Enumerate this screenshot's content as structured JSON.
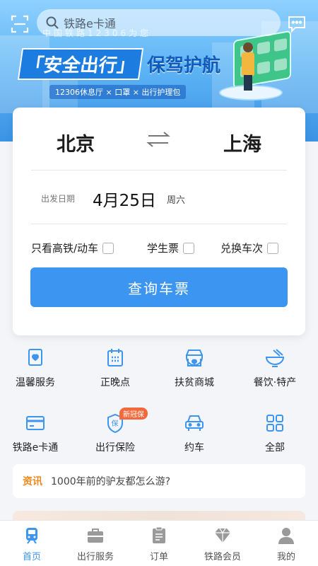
{
  "banner": {
    "subtitle": "中国铁路12306为您",
    "headline_main": "「安全出行」",
    "headline_rest": "保驾护航",
    "tagline": "12306休息厅 × 口罩 × 出行护理包"
  },
  "search": {
    "placeholder": "铁路e卡通"
  },
  "booking": {
    "from_city": "北京",
    "to_city": "上海",
    "date_label": "出发日期",
    "date_value": "4月25日",
    "weekday": "周六",
    "options": [
      {
        "label": "只看高铁/动车",
        "checked": false
      },
      {
        "label": "学生票",
        "checked": false
      },
      {
        "label": "兑换车次",
        "checked": false
      }
    ],
    "query_button": "查询车票"
  },
  "services": [
    {
      "label": "温馨服务",
      "icon": "heart-ticket-icon"
    },
    {
      "label": "正晚点",
      "icon": "calendar-icon"
    },
    {
      "label": "扶贫商城",
      "icon": "shop-icon"
    },
    {
      "label": "餐饮·特产",
      "icon": "bowl-icon"
    },
    {
      "label": "铁路e卡通",
      "icon": "card-icon"
    },
    {
      "label": "出行保险",
      "icon": "shield-icon",
      "badge": "新冠保"
    },
    {
      "label": "约车",
      "icon": "car-icon"
    },
    {
      "label": "全部",
      "icon": "grid-icon"
    }
  ],
  "news": {
    "tag": "资讯",
    "text": "1000年前的驴友都怎么游?"
  },
  "tabbar": {
    "items": [
      {
        "label": "首页",
        "icon": "train-icon",
        "active": true
      },
      {
        "label": "出行服务",
        "icon": "briefcase-icon",
        "active": false
      },
      {
        "label": "订单",
        "icon": "order-icon",
        "active": false
      },
      {
        "label": "铁路会员",
        "icon": "diamond-icon",
        "active": false
      },
      {
        "label": "我的",
        "icon": "user-icon",
        "active": false
      }
    ]
  },
  "colors": {
    "primary": "#3c95f0",
    "accent": "#f08a1e",
    "badge": "#f26a3b"
  }
}
